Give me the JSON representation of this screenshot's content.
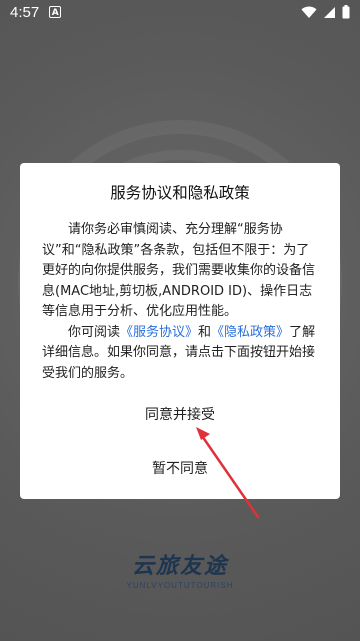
{
  "status_bar": {
    "time": "4:57",
    "notification_glyph": "A",
    "icons": [
      "wifi-icon",
      "signal-icon",
      "battery-icon"
    ]
  },
  "dialog": {
    "title": "服务协议和隐私政策",
    "paragraph1": "请你务必审慎阅读、充分理解“服务协议”和“隐私政策”各条款，包括但不限于：为了更好的向你提供服务，我们需要收集你的设备信息(MAC地址,剪切板,ANDROID ID)、操作日志等信息用于分析、优化应用性能。",
    "paragraph2_prefix": "你可阅读",
    "service_link": "《服务协议》",
    "and_text": "和",
    "privacy_link": "《隐私政策》",
    "paragraph2_suffix": "了解详细信息。如果你同意，请点击下面按钮开始接受我们的服务。",
    "agree_label": "同意并接受",
    "decline_label": "暂不同意"
  },
  "brand": {
    "name": "云旅友途",
    "subtitle": "YUNLVYOUTUTOURISH"
  },
  "colors": {
    "link": "#2a6fdb",
    "annotation_arrow": "#e0313a",
    "brand": "#1e3550"
  }
}
